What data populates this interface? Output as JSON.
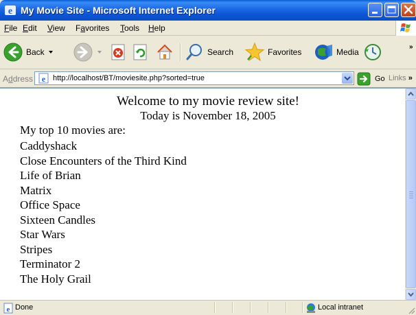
{
  "window": {
    "title": "My Movie Site - Microsoft Internet Explorer"
  },
  "menu": {
    "file": {
      "hot": "F",
      "rest": "ile"
    },
    "edit": {
      "hot": "E",
      "rest": "dit"
    },
    "view": {
      "hot": "V",
      "rest": "iew"
    },
    "favorites": {
      "pre": "F",
      "hot": "a",
      "rest": "vorites"
    },
    "tools": {
      "hot": "T",
      "rest": "ools"
    },
    "help": {
      "hot": "H",
      "rest": "elp"
    }
  },
  "toolbar": {
    "back_label": "Back",
    "search_label": "Search",
    "favorites_label": "Favorites",
    "media_label": "Media"
  },
  "address": {
    "label_hot": "d",
    "label_pre": "A",
    "label_rest": "dress",
    "url": "http://localhost/BT/moviesite.php?sorted=true",
    "go_label": "Go",
    "links_label": "Links"
  },
  "page": {
    "heading": "Welcome to my movie review site!",
    "date": "Today is November 18, 2005",
    "intro": "My top 10 movies are:",
    "movies": [
      "Caddyshack",
      "Close Encounters of the Third Kind",
      "Life of Brian",
      "Matrix",
      "Office Space",
      "Sixteen Candles",
      "Star Wars",
      "Stripes",
      "Terminator 2",
      "The Holy Grail"
    ]
  },
  "status": {
    "text": "Done",
    "zone": "Local intranet"
  },
  "icons": [
    "ie-icon",
    "minimize-icon",
    "maximize-icon",
    "close-icon",
    "windows-flag-icon",
    "back-arrow-icon",
    "forward-arrow-icon",
    "stop-icon",
    "refresh-icon",
    "home-icon",
    "search-icon",
    "favorites-star-icon",
    "media-icon",
    "history-icon",
    "page-icon",
    "go-arrow-icon",
    "done-page-icon",
    "local-intranet-icon"
  ],
  "colors": {
    "titlebar": "#0a5fd8",
    "close_button": "#c2401a",
    "chrome": "#ece9d8"
  }
}
